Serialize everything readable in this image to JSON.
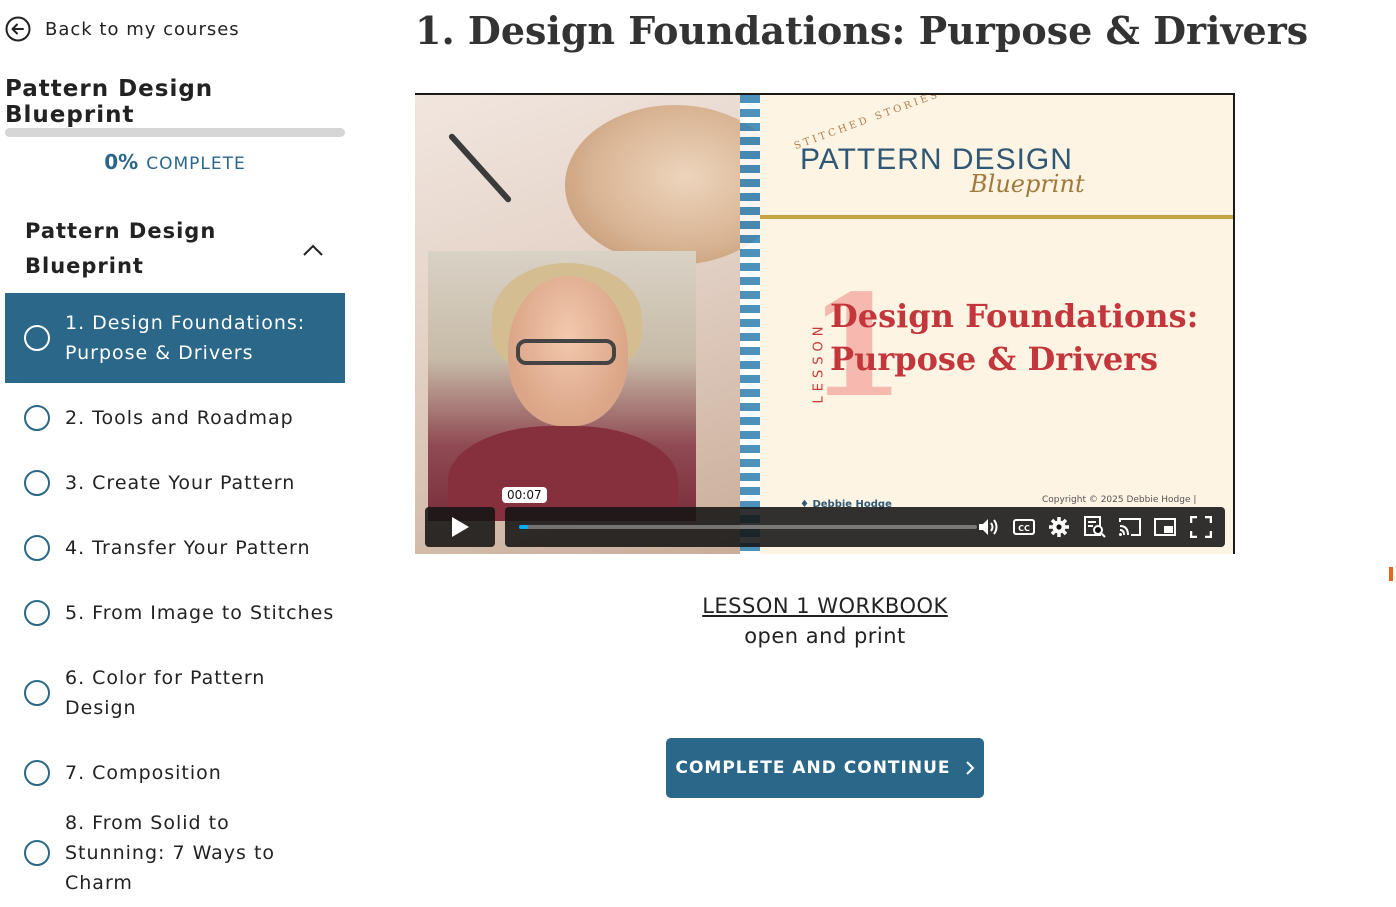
{
  "sidebar": {
    "back_label": "Back to my courses",
    "course_title": "Pattern Design Blueprint",
    "progress": {
      "percent_text": "0%",
      "label": "COMPLETE",
      "fraction": 0
    },
    "section": {
      "title": "Pattern Design Blueprint",
      "expanded": true
    },
    "lessons": [
      {
        "label": "1. Design Foundations: Purpose & Drivers",
        "active": true
      },
      {
        "label": "2. Tools and Roadmap",
        "active": false
      },
      {
        "label": "3. Create Your Pattern",
        "active": false
      },
      {
        "label": "4. Transfer Your Pattern",
        "active": false
      },
      {
        "label": "5. From Image to Stitches",
        "active": false
      },
      {
        "label": "6. Color for Pattern Design",
        "active": false
      },
      {
        "label": "7. Composition",
        "active": false
      },
      {
        "label": "8. From Solid to Stunning: 7 Ways to Charm",
        "active": false
      }
    ]
  },
  "main": {
    "title": "1. Design Foundations: Purpose & Drivers",
    "video": {
      "current_time": "00:07",
      "progress_fraction": 0.02,
      "slide": {
        "brand_small": "STITCHED STORIES",
        "brand_main": "PATTERN DESIGN",
        "brand_script": "Blueprint",
        "lesson_word": "LESSON",
        "lesson_number": "1",
        "heading": "Design Foundations: Purpose & Drivers",
        "footer_left": "♦ Debbie Hodge",
        "footer_right": "Copyright © 2025 Debbie Hodge |"
      }
    },
    "workbook": {
      "link_text": "LESSON 1 WORKBOOK",
      "sub_text": "open and print"
    },
    "complete_button": "COMPLETE AND CONTINUE"
  },
  "colors": {
    "primary": "#2a6789",
    "accent_marker": "#e8641a",
    "video_progress": "#00adef"
  }
}
